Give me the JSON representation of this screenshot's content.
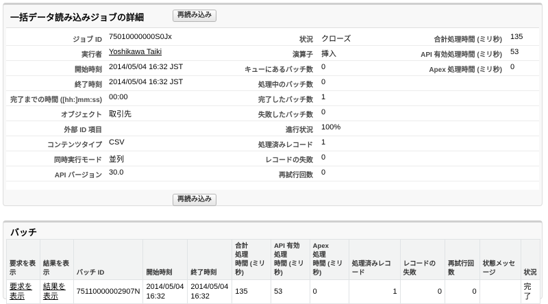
{
  "detail": {
    "title": "一括データ読み込みジョブの詳細",
    "reload_label": "再読み込み",
    "col1": [
      {
        "label": "ジョブ ID",
        "value": "75010000000S0Jx"
      },
      {
        "label": "実行者",
        "value": "Yoshikawa Taiki"
      },
      {
        "label": "開始時刻",
        "value": "2014/05/04 16:32 JST"
      },
      {
        "label": "終了時刻",
        "value": "2014/05/04 16:32 JST"
      },
      {
        "label": "完了までの時間 ([hh:]mm:ss)",
        "value": "00:00"
      },
      {
        "label": "オブジェクト",
        "value": "取引先"
      },
      {
        "label": "外部 ID 項目",
        "value": ""
      },
      {
        "label": "コンテンツタイプ",
        "value": "CSV"
      },
      {
        "label": "同時実行モード",
        "value": "並列"
      },
      {
        "label": "API バージョン",
        "value": "30.0"
      }
    ],
    "col2": [
      {
        "label": "状況",
        "value": "クローズ"
      },
      {
        "label": "演算子",
        "value": "挿入"
      },
      {
        "label": "キューにあるバッチ数",
        "value": "0"
      },
      {
        "label": "処理中のバッチ数",
        "value": "0"
      },
      {
        "label": "完了したバッチ数",
        "value": "1"
      },
      {
        "label": "失敗したバッチ数",
        "value": "0"
      },
      {
        "label": "進行状況",
        "value": "100%"
      },
      {
        "label": "処理済みレコード",
        "value": "1"
      },
      {
        "label": "レコードの失敗",
        "value": "0"
      },
      {
        "label": "再試行回数",
        "value": "0"
      }
    ],
    "col3": [
      {
        "label": "合計処理時間 (ミリ秒)",
        "value": "135"
      },
      {
        "label": "API 有効処理時間 (ミリ秒)",
        "value": "53"
      },
      {
        "label": "Apex 処理時間 (ミリ秒)",
        "value": "0"
      }
    ]
  },
  "batch": {
    "title": "バッチ",
    "headers": [
      [
        "要求を表示"
      ],
      [
        "結果を表示"
      ],
      [
        "バッチ ID"
      ],
      [
        "開始時刻"
      ],
      [
        "終了時刻"
      ],
      [
        "合計",
        "処理",
        "時間 (ミリ秒)"
      ],
      [
        "API 有効",
        "処理",
        "時間 (ミリ秒)"
      ],
      [
        "Apex",
        "処理",
        "時間 (ミリ秒)"
      ],
      [
        "処理済みレコード"
      ],
      [
        "レコードの失敗"
      ],
      [
        "再試行回数"
      ],
      [
        "状態メッセージ"
      ],
      [
        "状況"
      ]
    ],
    "row": {
      "view_request": "要求を表示",
      "view_result": "結果を表示",
      "batch_id": "75110000002907N",
      "start": "2014/05/04 16:32",
      "end": "2014/05/04 16:32",
      "total_time": "135",
      "api_time": "53",
      "apex_time": "0",
      "processed": "1",
      "failed": "0",
      "retries": "0",
      "message": "",
      "status": "完了"
    }
  }
}
